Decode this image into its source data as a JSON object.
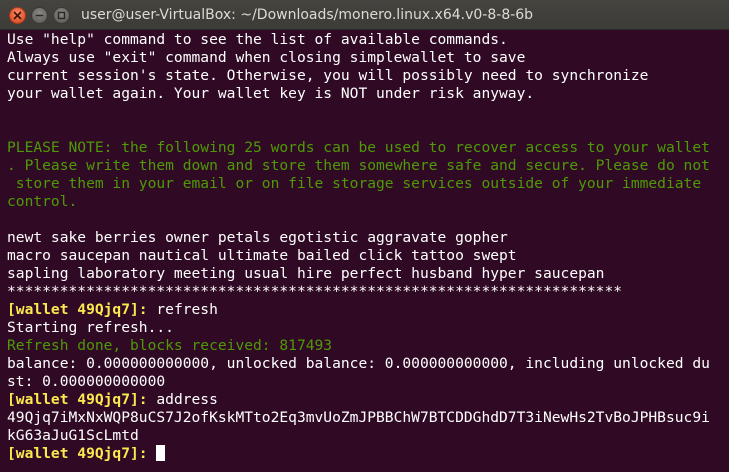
{
  "window": {
    "title": "user@user-VirtualBox: ~/Downloads/monero.linux.x64.v0-8-8-6b"
  },
  "terminal": {
    "lines": [
      {
        "text": "Use \"help\" command to see the list of available commands.",
        "style": "white"
      },
      {
        "text": "Always use \"exit\" command when closing simplewallet to save",
        "style": "white"
      },
      {
        "text": "current session's state. Otherwise, you will possibly need to synchronize",
        "style": "white"
      },
      {
        "text": "your wallet again. Your wallet key is NOT under risk anyway.",
        "style": "white"
      },
      {
        "text": "",
        "style": "white"
      },
      {
        "text": "",
        "style": "white"
      },
      {
        "text": "PLEASE NOTE: the following 25 words can be used to recover access to your wallet",
        "style": "green"
      },
      {
        "text": ". Please write them down and store them somewhere safe and secure. Please do not",
        "style": "green"
      },
      {
        "text": " store them in your email or on file storage services outside of your immediate",
        "style": "green"
      },
      {
        "text": "control.",
        "style": "green"
      },
      {
        "text": "",
        "style": "white"
      },
      {
        "text": "newt sake berries owner petals egotistic aggravate gopher",
        "style": "white"
      },
      {
        "text": "macro saucepan nautical ultimate bailed click tattoo swept",
        "style": "white"
      },
      {
        "text": "sapling laboratory meeting usual hire perfect husband hyper saucepan",
        "style": "white"
      },
      {
        "text": "**********************************************************************",
        "style": "white"
      }
    ],
    "prompt": "[wallet 49Qjq7]:",
    "command_refresh": " refresh",
    "starting_refresh": "Starting refresh...",
    "refresh_done": "Refresh done, blocks received: 817493",
    "balance_line1": "balance: 0.000000000000, unlocked balance: 0.000000000000, including unlocked du",
    "balance_line2": "st: 0.000000000000",
    "command_address": " address",
    "address_line1": "49Qjq7iMxNxWQP8uCS7J2ofKskMTto2Eq3mvUoZmJPBBChW7BTCDDGhdD7T3iNewHs2TvBoJPHBsuc9i",
    "address_line2": "kG63aJuG1ScLmtd",
    "final_prompt_suffix": " "
  },
  "colors": {
    "background": "#300a24",
    "text": "#ffffff",
    "green": "#4e9a06",
    "prompt_yellow": "#fce94f",
    "close_button": "#e2562c"
  }
}
